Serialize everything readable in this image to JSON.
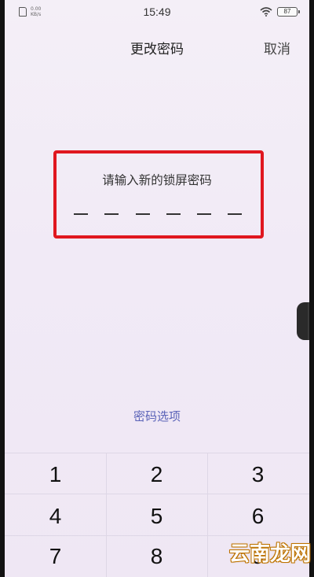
{
  "status_bar": {
    "net_speed_value": "0.00",
    "net_speed_unit": "KB/s",
    "time": "15:49",
    "battery_level": "87"
  },
  "header": {
    "title": "更改密码",
    "cancel_label": "取消"
  },
  "prompt": {
    "text": "请输入新的锁屏密码",
    "pin_length": 6,
    "highlight_color": "#e0171f"
  },
  "options_link": {
    "label": "密码选项",
    "color": "#5b63b8"
  },
  "keypad": {
    "keys": [
      "1",
      "2",
      "3",
      "4",
      "5",
      "6",
      "7",
      "8",
      "9"
    ]
  },
  "watermark": {
    "text": "云南龙网"
  }
}
